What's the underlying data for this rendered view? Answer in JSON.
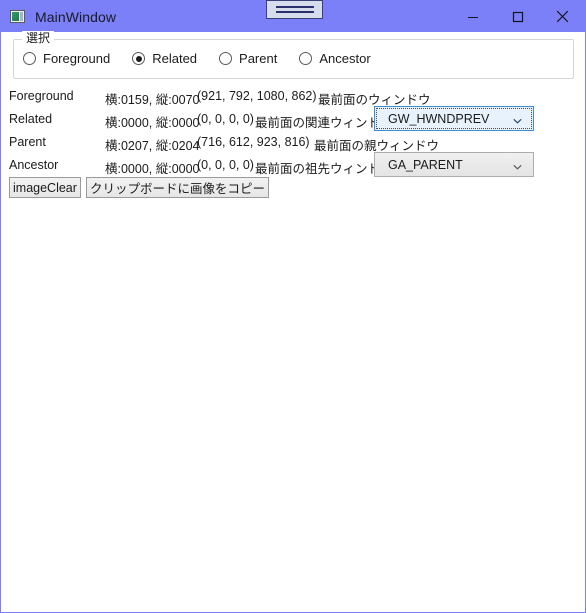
{
  "window": {
    "title": "MainWindow",
    "icon": "app-window-icon",
    "accent_color": "#7b7ff8",
    "client_background": "#ffffff"
  },
  "caption": {
    "minimize_label": "Minimize",
    "maximize_label": "Maximize",
    "close_label": "Close"
  },
  "overlay_chip": {
    "name": "floating-handle-chip",
    "lines": 2
  },
  "groupbox": {
    "label": "選択",
    "radios": [
      {
        "label": "Foreground",
        "checked": false
      },
      {
        "label": "Related",
        "checked": true
      },
      {
        "label": "Parent",
        "checked": false
      },
      {
        "label": "Ancestor",
        "checked": false
      }
    ]
  },
  "rows": [
    {
      "name": "Foreground",
      "metrics": "横:0159, 縦:0070",
      "rect": "(921, 792, 1080, 862)",
      "description": "最前面のウィンドウ",
      "combo": null
    },
    {
      "name": "Related",
      "metrics": "横:0000, 縦:0000",
      "rect": "(0, 0, 0, 0)",
      "description": "最前面の関連ウィンドウ",
      "combo": {
        "value": "GW_HWNDPREV",
        "focused": true,
        "name": "related-combo"
      }
    },
    {
      "name": "Parent",
      "metrics": "横:0207, 縦:0204",
      "rect": "(716, 612, 923, 816)",
      "description": "最前面の親ウィンドウ",
      "combo": null
    },
    {
      "name": "Ancestor",
      "metrics": "横:0000, 縦:0000",
      "rect": "(0, 0, 0, 0)",
      "description": "最前面の祖先ウィンドウ",
      "combo": {
        "value": "GA_PARENT",
        "focused": false,
        "name": "ancestor-combo"
      }
    }
  ],
  "buttons": {
    "image_clear": "imageClear",
    "copy_to_clipboard": "クリップボードに画像をコピー"
  }
}
